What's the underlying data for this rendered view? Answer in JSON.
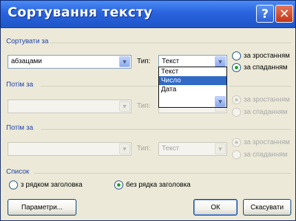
{
  "window": {
    "title": "Сортування тексту",
    "help_label": "?",
    "close_label": "✕"
  },
  "sort_by": {
    "group_label": "Сортувати за",
    "field_value": "абзацами",
    "type_label": "Тип:",
    "type_value": "Текст",
    "type_options": [
      "Текст",
      "Число",
      "Дата"
    ],
    "selected_option": "Число",
    "ascending_label": "за зростанням",
    "descending_label": "за спаданням",
    "order": "descending"
  },
  "then_by_1": {
    "group_label": "Потім за",
    "field_value": "",
    "type_label": "Тип:",
    "ascending_label": "за зростанням",
    "descending_label": "за спаданням",
    "order": "ascending"
  },
  "then_by_2": {
    "group_label": "Потім за",
    "field_value": "",
    "type_label": "Тип:",
    "type_value": "Текст",
    "ascending_label": "за зростанням",
    "descending_label": "за спаданням",
    "order": "ascending"
  },
  "list": {
    "group_label": "Список",
    "with_header_label": "з рядком заголовка",
    "without_header_label": "без рядка заголовка",
    "selected": "without_header"
  },
  "buttons": {
    "options_label": "Параметри...",
    "ok_label": "ОК",
    "cancel_label": "Скасувати"
  },
  "colors": {
    "title_bar": "#2a63de",
    "dialog_bg": "#ece9d8",
    "selection": "#316ac5",
    "close_button": "#c33512",
    "radio_dot": "#21a121"
  }
}
